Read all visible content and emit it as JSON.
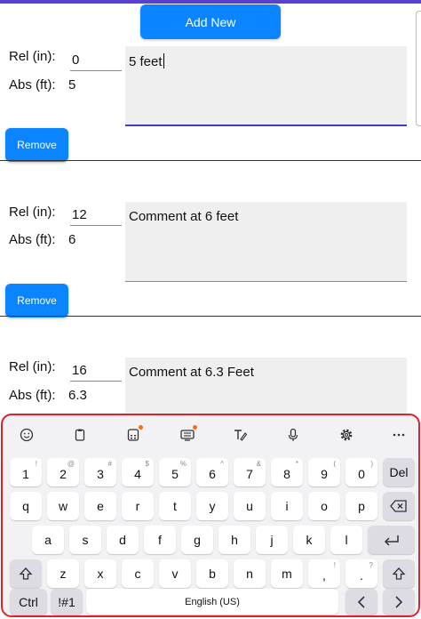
{
  "toolbar": {
    "add_label": "Add New"
  },
  "entries": [
    {
      "rel_label": "Rel (in):",
      "rel_value": "0",
      "abs_label": "Abs (ft):",
      "abs_value": "5",
      "comment": "5 feet",
      "remove_label": "Remove"
    },
    {
      "rel_label": "Rel (in):",
      "rel_value": "12",
      "abs_label": "Abs (ft):",
      "abs_value": "6",
      "comment": "Comment at 6 feet",
      "remove_label": "Remove"
    },
    {
      "rel_label": "Rel (in):",
      "rel_value": "16",
      "abs_label": "Abs (ft):",
      "abs_value": "6.3",
      "comment": "Comment at 6.3 Feet"
    }
  ],
  "keyboard": {
    "toolbar_icons": [
      "emoji-icon",
      "clipboard-icon",
      "calculator-icon",
      "keyboard-mode-icon",
      "handwriting-icon",
      "microphone-icon",
      "settings-icon",
      "more-icon"
    ],
    "row1": [
      {
        "k": "1",
        "h": "!"
      },
      {
        "k": "2",
        "h": "@"
      },
      {
        "k": "3",
        "h": "#"
      },
      {
        "k": "4",
        "h": "$"
      },
      {
        "k": "5",
        "h": "%"
      },
      {
        "k": "6",
        "h": "^"
      },
      {
        "k": "7",
        "h": "&"
      },
      {
        "k": "8",
        "h": "*"
      },
      {
        "k": "9",
        "h": "("
      },
      {
        "k": "0",
        "h": ")"
      }
    ],
    "del_label": "Del",
    "row2": [
      "q",
      "w",
      "e",
      "r",
      "t",
      "y",
      "u",
      "i",
      "o",
      "p"
    ],
    "row3": [
      "a",
      "s",
      "d",
      "f",
      "g",
      "h",
      "j",
      "k",
      "l"
    ],
    "row4": [
      {
        "k": "z",
        "h": ""
      },
      {
        "k": "x",
        "h": ""
      },
      {
        "k": "c",
        "h": ""
      },
      {
        "k": "v",
        "h": ""
      },
      {
        "k": "b",
        "h": ""
      },
      {
        "k": "n",
        "h": ""
      },
      {
        "k": "m",
        "h": ""
      },
      {
        "k": ",",
        "h": "!"
      },
      {
        "k": ".",
        "h": "?"
      }
    ],
    "ctrl_label": "Ctrl",
    "symbols_label": "!#1",
    "space_label": "English (US)",
    "accent_color": "#ff6a1a"
  },
  "colors": {
    "primary": "#0a84ff",
    "focus": "#3d3dc8",
    "highlight": "#e0202a",
    "top_bar": "#5b3fd1"
  }
}
